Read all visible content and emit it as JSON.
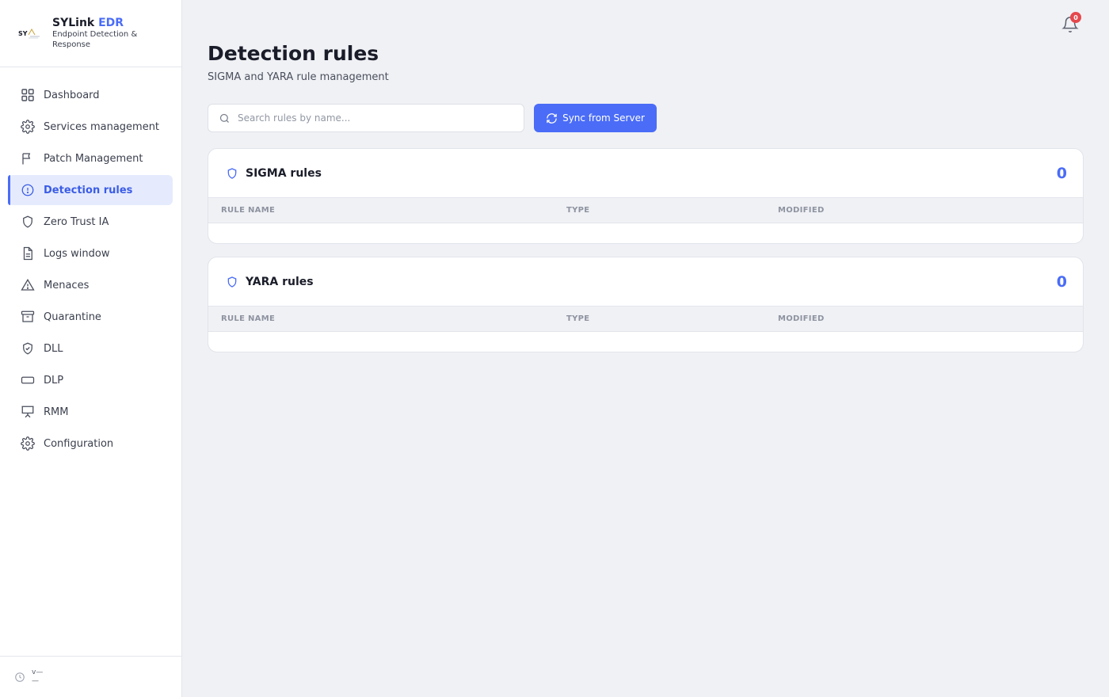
{
  "brand": {
    "title": "SYLink",
    "title_accent": "EDR",
    "subtitle": "Endpoint Detection & Response",
    "logo_text": "SY"
  },
  "sidebar": {
    "items": [
      {
        "label": "Dashboard",
        "icon": "grid-icon"
      },
      {
        "label": "Services management",
        "icon": "gear-icon"
      },
      {
        "label": "Patch Management",
        "icon": "flag-icon"
      },
      {
        "label": "Detection rules",
        "icon": "alert-circle-icon",
        "active": true
      },
      {
        "label": "Zero Trust IA",
        "icon": "shield-icon"
      },
      {
        "label": "Logs window",
        "icon": "file-icon"
      },
      {
        "label": "Menaces",
        "icon": "warning-triangle-icon"
      },
      {
        "label": "Quarantine",
        "icon": "archive-icon"
      },
      {
        "label": "DLL",
        "icon": "shield-check-icon"
      },
      {
        "label": "DLP",
        "icon": "keyboard-icon"
      },
      {
        "label": "RMM",
        "icon": "presentation-icon"
      },
      {
        "label": "Configuration",
        "icon": "gear-icon"
      }
    ],
    "footer": {
      "version_line1": "v—",
      "version_line2": "—",
      "icon": "clock-icon"
    }
  },
  "header": {
    "notification_count": "0"
  },
  "page": {
    "title": "Detection rules",
    "subtitle": "SIGMA and YARA rule management"
  },
  "search": {
    "placeholder": "Search rules by name...",
    "value": ""
  },
  "toolbar": {
    "sync_label": "Sync from Server"
  },
  "sections": {
    "sigma": {
      "title": "SIGMA rules",
      "count": "0",
      "columns": [
        "RULE NAME",
        "TYPE",
        "MODIFIED"
      ]
    },
    "yara": {
      "title": "YARA rules",
      "count": "0",
      "columns": [
        "RULE NAME",
        "TYPE",
        "MODIFIED"
      ]
    }
  },
  "colors": {
    "accent": "#4a6cf7",
    "badge": "#e5484d",
    "background": "#f0f1f5"
  }
}
